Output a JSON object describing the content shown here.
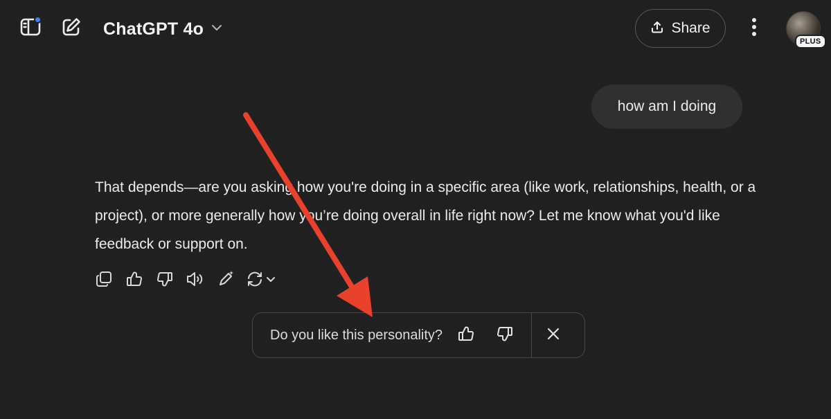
{
  "header": {
    "model_name": "ChatGPT 4o",
    "share_label": "Share",
    "avatar_badge": "PLUS",
    "notification_dot_color": "#3b82f6",
    "icons": [
      "sidebar-toggle-icon",
      "new-chat-icon",
      "chevron-down-icon",
      "share-upload-icon",
      "more-vertical-icon"
    ]
  },
  "conversation": {
    "user_message": "how am I doing",
    "assistant_message": "That depends—are you asking how you're doing in a specific area (like work, relationships, health, or a project), or more generally how you’re doing overall in life right now? Let me know what you'd like feedback or support on.",
    "actions": [
      "copy-icon",
      "thumbs-up-icon",
      "thumbs-down-icon",
      "read-aloud-icon",
      "edit-in-canvas-icon",
      "regenerate-icon",
      "chevron-down-icon"
    ]
  },
  "feedback": {
    "question": "Do you like this personality?",
    "icons": [
      "thumbs-up-icon",
      "thumbs-down-icon",
      "close-icon"
    ]
  },
  "annotation": {
    "arrow_color": "#e8412c"
  },
  "colors": {
    "background": "#212121",
    "bubble": "#303030",
    "text": "#ececec"
  }
}
